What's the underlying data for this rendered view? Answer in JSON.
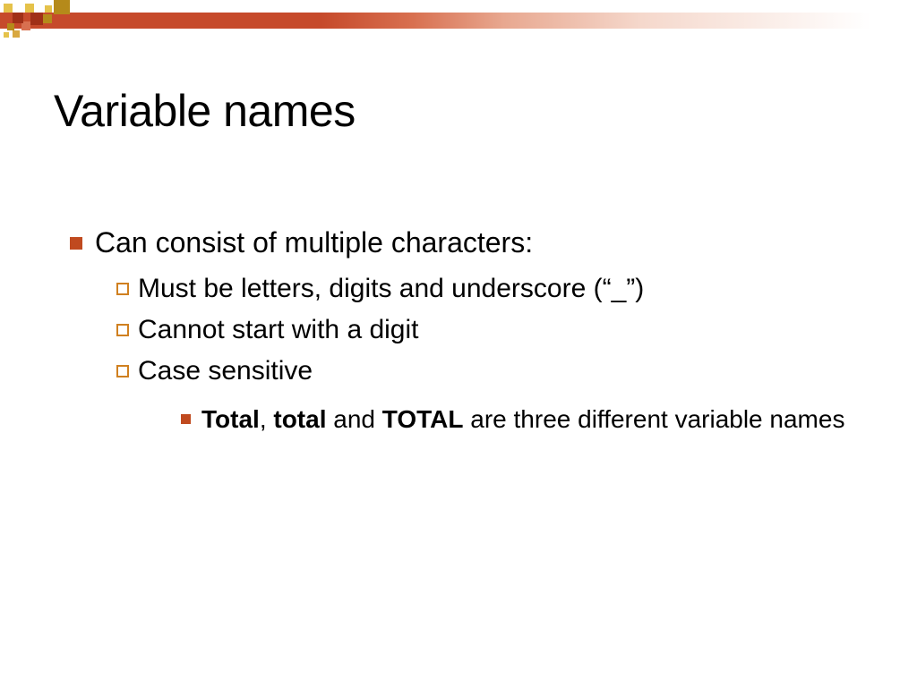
{
  "title": "Variable names",
  "bullets": {
    "level1": "Can consist of multiple characters:",
    "level2_a": "Must be letters, digits and underscore (“_”)",
    "level2_b": "Cannot start with a digit",
    "level2_c": "Case sensitive",
    "level3_prefix_bold1": "Total",
    "level3_sep1": ", ",
    "level3_bold2": "total",
    "level3_mid": " and ",
    "level3_bold3": "TOTAL",
    "level3_suffix": " are three different variable names"
  }
}
